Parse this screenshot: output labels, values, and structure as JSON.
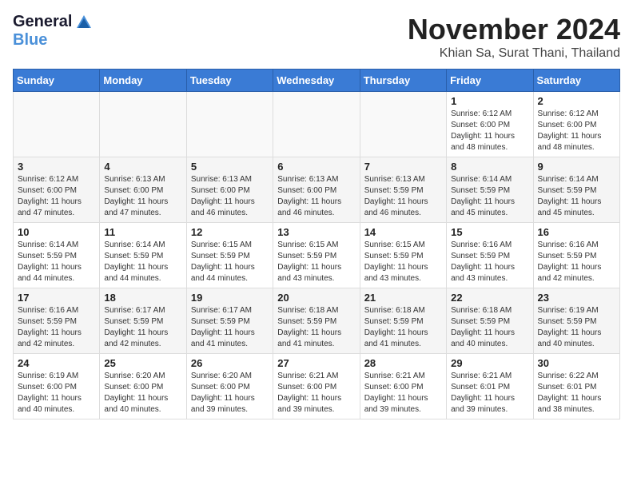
{
  "header": {
    "logo_general": "General",
    "logo_blue": "Blue",
    "month_title": "November 2024",
    "location": "Khian Sa, Surat Thani, Thailand"
  },
  "weekdays": [
    "Sunday",
    "Monday",
    "Tuesday",
    "Wednesday",
    "Thursday",
    "Friday",
    "Saturday"
  ],
  "weeks": [
    [
      {
        "day": "",
        "info": ""
      },
      {
        "day": "",
        "info": ""
      },
      {
        "day": "",
        "info": ""
      },
      {
        "day": "",
        "info": ""
      },
      {
        "day": "",
        "info": ""
      },
      {
        "day": "1",
        "info": "Sunrise: 6:12 AM\nSunset: 6:00 PM\nDaylight: 11 hours\nand 48 minutes."
      },
      {
        "day": "2",
        "info": "Sunrise: 6:12 AM\nSunset: 6:00 PM\nDaylight: 11 hours\nand 48 minutes."
      }
    ],
    [
      {
        "day": "3",
        "info": "Sunrise: 6:12 AM\nSunset: 6:00 PM\nDaylight: 11 hours\nand 47 minutes."
      },
      {
        "day": "4",
        "info": "Sunrise: 6:13 AM\nSunset: 6:00 PM\nDaylight: 11 hours\nand 47 minutes."
      },
      {
        "day": "5",
        "info": "Sunrise: 6:13 AM\nSunset: 6:00 PM\nDaylight: 11 hours\nand 46 minutes."
      },
      {
        "day": "6",
        "info": "Sunrise: 6:13 AM\nSunset: 6:00 PM\nDaylight: 11 hours\nand 46 minutes."
      },
      {
        "day": "7",
        "info": "Sunrise: 6:13 AM\nSunset: 5:59 PM\nDaylight: 11 hours\nand 46 minutes."
      },
      {
        "day": "8",
        "info": "Sunrise: 6:14 AM\nSunset: 5:59 PM\nDaylight: 11 hours\nand 45 minutes."
      },
      {
        "day": "9",
        "info": "Sunrise: 6:14 AM\nSunset: 5:59 PM\nDaylight: 11 hours\nand 45 minutes."
      }
    ],
    [
      {
        "day": "10",
        "info": "Sunrise: 6:14 AM\nSunset: 5:59 PM\nDaylight: 11 hours\nand 44 minutes."
      },
      {
        "day": "11",
        "info": "Sunrise: 6:14 AM\nSunset: 5:59 PM\nDaylight: 11 hours\nand 44 minutes."
      },
      {
        "day": "12",
        "info": "Sunrise: 6:15 AM\nSunset: 5:59 PM\nDaylight: 11 hours\nand 44 minutes."
      },
      {
        "day": "13",
        "info": "Sunrise: 6:15 AM\nSunset: 5:59 PM\nDaylight: 11 hours\nand 43 minutes."
      },
      {
        "day": "14",
        "info": "Sunrise: 6:15 AM\nSunset: 5:59 PM\nDaylight: 11 hours\nand 43 minutes."
      },
      {
        "day": "15",
        "info": "Sunrise: 6:16 AM\nSunset: 5:59 PM\nDaylight: 11 hours\nand 43 minutes."
      },
      {
        "day": "16",
        "info": "Sunrise: 6:16 AM\nSunset: 5:59 PM\nDaylight: 11 hours\nand 42 minutes."
      }
    ],
    [
      {
        "day": "17",
        "info": "Sunrise: 6:16 AM\nSunset: 5:59 PM\nDaylight: 11 hours\nand 42 minutes."
      },
      {
        "day": "18",
        "info": "Sunrise: 6:17 AM\nSunset: 5:59 PM\nDaylight: 11 hours\nand 42 minutes."
      },
      {
        "day": "19",
        "info": "Sunrise: 6:17 AM\nSunset: 5:59 PM\nDaylight: 11 hours\nand 41 minutes."
      },
      {
        "day": "20",
        "info": "Sunrise: 6:18 AM\nSunset: 5:59 PM\nDaylight: 11 hours\nand 41 minutes."
      },
      {
        "day": "21",
        "info": "Sunrise: 6:18 AM\nSunset: 5:59 PM\nDaylight: 11 hours\nand 41 minutes."
      },
      {
        "day": "22",
        "info": "Sunrise: 6:18 AM\nSunset: 5:59 PM\nDaylight: 11 hours\nand 40 minutes."
      },
      {
        "day": "23",
        "info": "Sunrise: 6:19 AM\nSunset: 5:59 PM\nDaylight: 11 hours\nand 40 minutes."
      }
    ],
    [
      {
        "day": "24",
        "info": "Sunrise: 6:19 AM\nSunset: 6:00 PM\nDaylight: 11 hours\nand 40 minutes."
      },
      {
        "day": "25",
        "info": "Sunrise: 6:20 AM\nSunset: 6:00 PM\nDaylight: 11 hours\nand 40 minutes."
      },
      {
        "day": "26",
        "info": "Sunrise: 6:20 AM\nSunset: 6:00 PM\nDaylight: 11 hours\nand 39 minutes."
      },
      {
        "day": "27",
        "info": "Sunrise: 6:21 AM\nSunset: 6:00 PM\nDaylight: 11 hours\nand 39 minutes."
      },
      {
        "day": "28",
        "info": "Sunrise: 6:21 AM\nSunset: 6:00 PM\nDaylight: 11 hours\nand 39 minutes."
      },
      {
        "day": "29",
        "info": "Sunrise: 6:21 AM\nSunset: 6:01 PM\nDaylight: 11 hours\nand 39 minutes."
      },
      {
        "day": "30",
        "info": "Sunrise: 6:22 AM\nSunset: 6:01 PM\nDaylight: 11 hours\nand 38 minutes."
      }
    ]
  ]
}
